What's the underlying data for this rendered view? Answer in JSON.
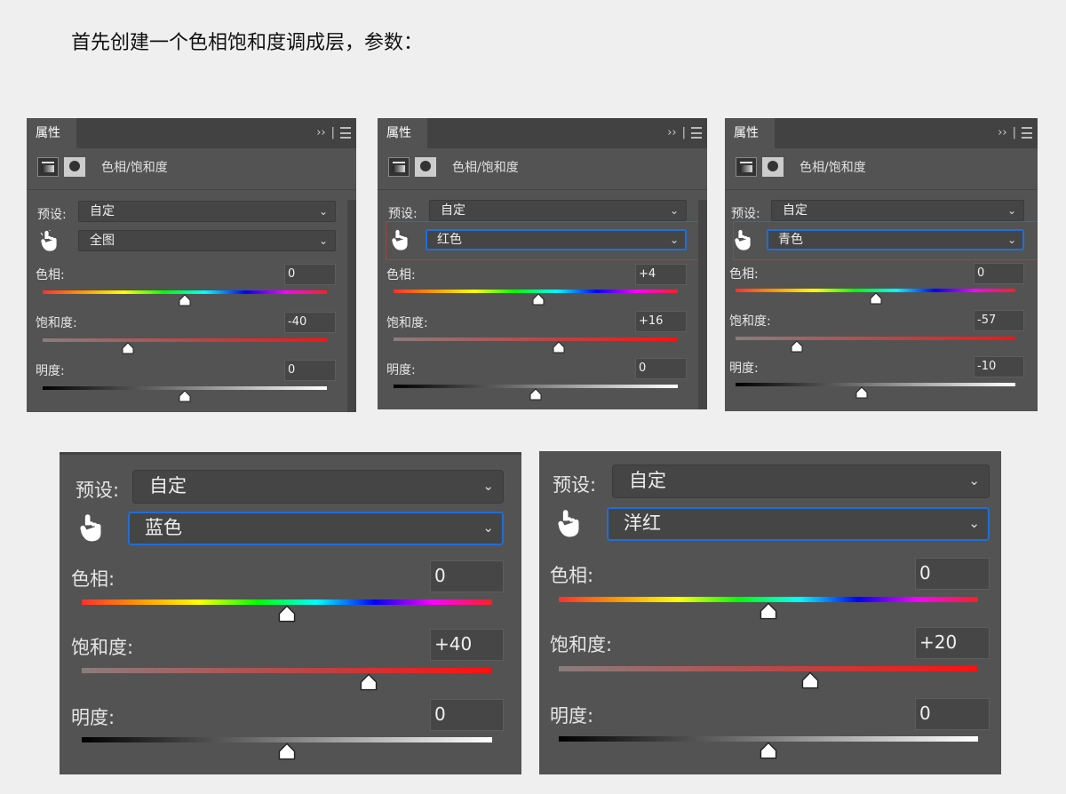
{
  "title": "首先创建一个色相饱和度调成层，参数：",
  "panel_common": {
    "tab_label": "属性",
    "collapse_glyph": "››",
    "divider_glyph": "|",
    "adjustment_label": "色相/饱和度",
    "preset_label": "预设:",
    "preset_value": "自定",
    "hue_label": "色相:",
    "saturation_label": "饱和度:",
    "lightness_label": "明度:",
    "chevron": "⌄",
    "icons": [
      "hue-saturation-icon",
      "mask-icon",
      "targeted-adjustment-hand-icon",
      "chevron-down-icon",
      "panel-menu-icon"
    ]
  },
  "panels": [
    {
      "channel": "全图",
      "hue": "0",
      "saturation": "-40",
      "lightness": "0",
      "hue_frac": 0.5,
      "sat_frac": 0.3,
      "light_frac": 0.5
    },
    {
      "channel": "红色",
      "hue": "+4",
      "saturation": "+16",
      "lightness": "0",
      "hue_frac": 0.51,
      "sat_frac": 0.58,
      "light_frac": 0.5
    },
    {
      "channel": "青色",
      "hue": "0",
      "saturation": "-57",
      "lightness": "-10",
      "hue_frac": 0.5,
      "sat_frac": 0.22,
      "light_frac": 0.45
    },
    {
      "channel": "蓝色",
      "hue": "0",
      "saturation": "+40",
      "lightness": "0",
      "hue_frac": 0.5,
      "sat_frac": 0.7,
      "light_frac": 0.5
    },
    {
      "channel": "洋红",
      "hue": "0",
      "saturation": "+20",
      "lightness": "0",
      "hue_frac": 0.5,
      "sat_frac": 0.6,
      "light_frac": 0.5
    }
  ]
}
